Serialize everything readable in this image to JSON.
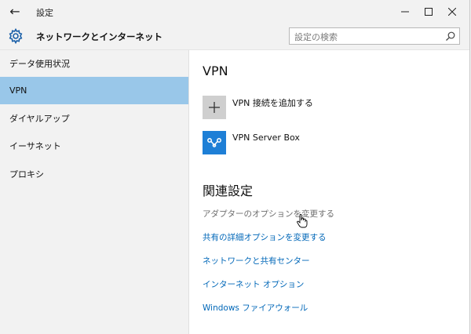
{
  "titlebar": {
    "back_icon": "back-arrow-icon",
    "title": "設定",
    "minimize_icon": "minimize-icon",
    "maximize_icon": "maximize-icon",
    "close_icon": "close-icon"
  },
  "header": {
    "icon": "gear-icon",
    "title": "ネットワークとインターネット",
    "search": {
      "placeholder": "設定の検索",
      "value": ""
    }
  },
  "sidebar": {
    "items": [
      {
        "label": "データ使用状況",
        "selected": false
      },
      {
        "label": "VPN",
        "selected": true
      },
      {
        "label": "ダイヤルアップ",
        "selected": false
      },
      {
        "label": "イーサネット",
        "selected": false
      },
      {
        "label": "プロキシ",
        "selected": false
      }
    ]
  },
  "main": {
    "heading": "VPN",
    "add_connection_label": "VPN 接続を追加する",
    "connection_name": "VPN Server Box",
    "related_heading": "関連設定",
    "links": [
      "アダプターのオプションを変更する",
      "共有の詳細オプションを変更する",
      "ネットワークと共有センター",
      "インターネット オプション",
      "Windows ファイアウォール"
    ]
  },
  "colors": {
    "selected_nav": "#99c7e9",
    "link": "#0067b8",
    "link_hover": "#6e6e6e",
    "vpn_tile": "#1e7fd6"
  }
}
